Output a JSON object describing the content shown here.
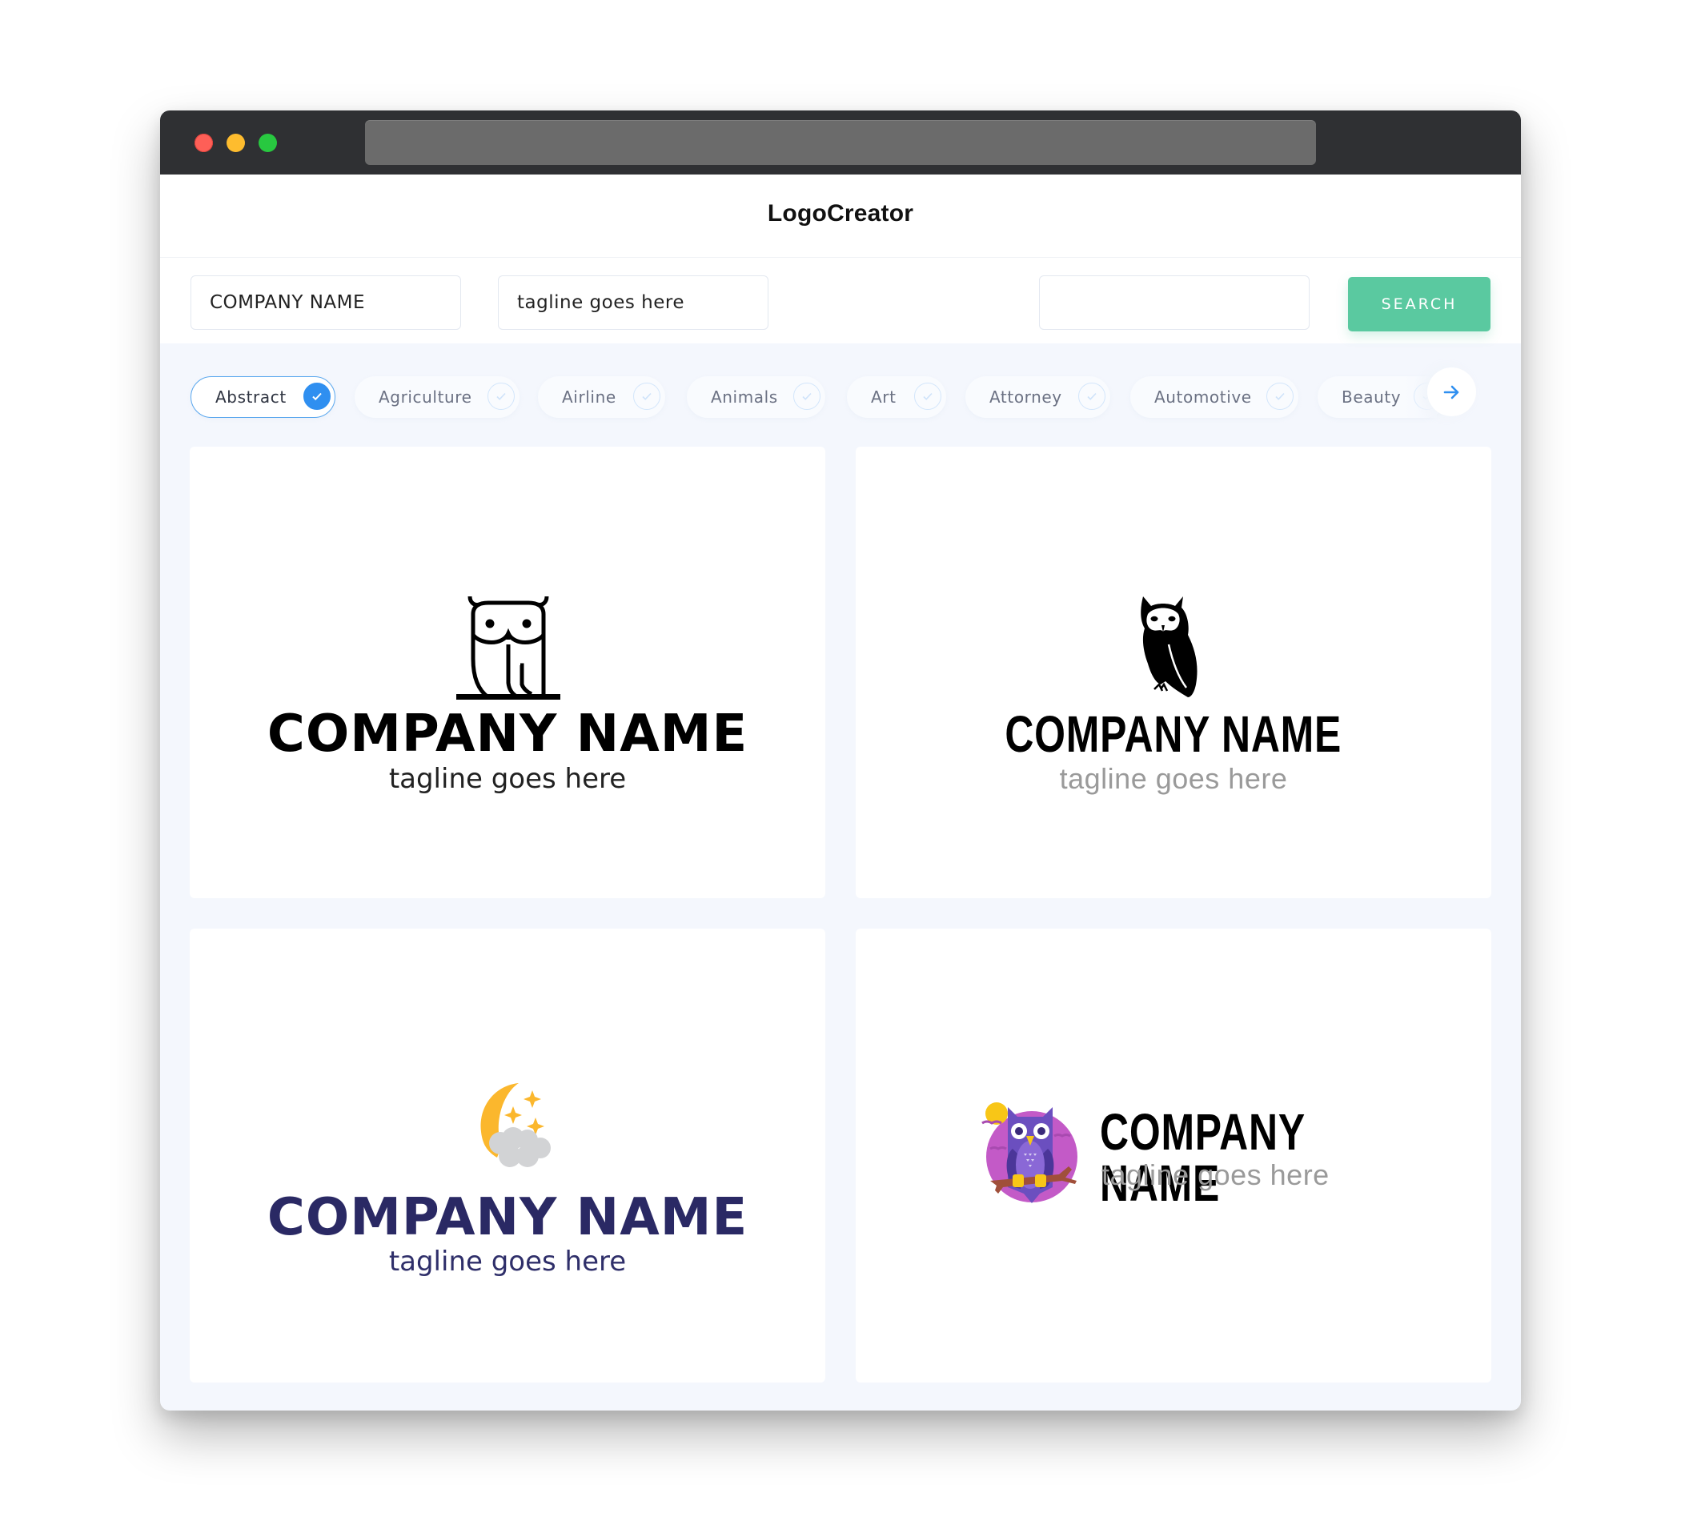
{
  "window": {
    "url_bar": ""
  },
  "header": {
    "brand": "LogoCreator"
  },
  "form": {
    "company_name_value": "COMPANY NAME",
    "tagline_value": "tagline goes here",
    "search_value": "",
    "search_button": "SEARCH"
  },
  "categories": [
    {
      "label": "Abstract",
      "selected": true
    },
    {
      "label": "Agriculture",
      "selected": false
    },
    {
      "label": "Airline",
      "selected": false
    },
    {
      "label": "Animals",
      "selected": false
    },
    {
      "label": "Art",
      "selected": false
    },
    {
      "label": "Attorney",
      "selected": false
    },
    {
      "label": "Automotive",
      "selected": false
    },
    {
      "label": "Beauty",
      "selected": false
    }
  ],
  "colors": {
    "accent_green": "#5ac9a0",
    "accent_blue": "#2f8ff0",
    "navy": "#2a2964",
    "moon_yellow": "#fbb72d",
    "owl_purple": "#6b4fbf",
    "circle_magenta": "#c35ac7"
  },
  "logos": [
    {
      "icon": "owl-outline-icon",
      "company": "COMPANY NAME",
      "tagline": "tagline goes here"
    },
    {
      "icon": "owl-silhouette-icon",
      "company": "COMPANY NAME",
      "tagline": "tagline goes here"
    },
    {
      "icon": "moon-cloud-stars-icon",
      "company": "COMPANY NAME",
      "tagline": "tagline goes here"
    },
    {
      "icon": "purple-owl-badge-icon",
      "company": "COMPANY NAME",
      "tagline": "tagline goes here"
    }
  ]
}
